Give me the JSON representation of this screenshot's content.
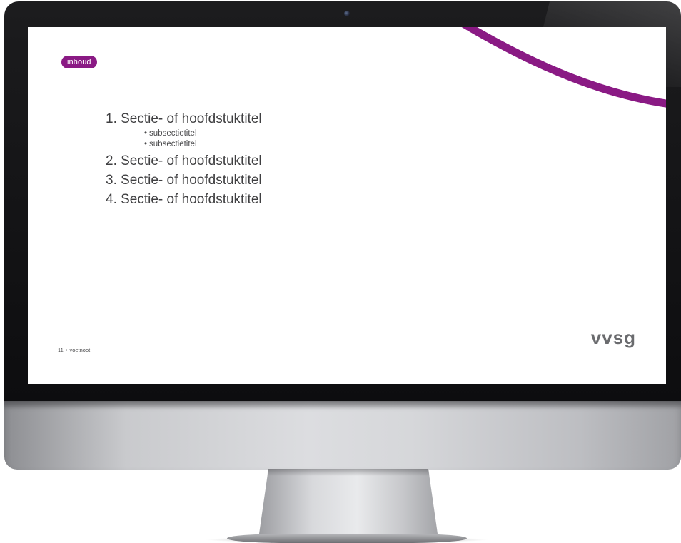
{
  "slide": {
    "tag": "inhoud",
    "toc": [
      {
        "label": "1. Sectie- of hoofdstuktitel",
        "subitems": [
          "subsectietitel",
          "subsectietitel"
        ]
      },
      {
        "label": "2. Sectie- of hoofdstuktitel",
        "subitems": []
      },
      {
        "label": "3. Sectie- of hoofdstuktitel",
        "subitems": []
      },
      {
        "label": "4. Sectie- of hoofdstuktitel",
        "subitems": []
      }
    ],
    "bullet": "•",
    "footer": {
      "page_number": "11",
      "separator": "•",
      "note": "voetnoot"
    },
    "logo_text": "vvsg"
  },
  "colors": {
    "accent": "#8a1a84",
    "text": "#3f3f41",
    "logo": "#6a6b6e",
    "bezel": "#111113"
  },
  "icons": {
    "camera": "webcam-icon"
  }
}
